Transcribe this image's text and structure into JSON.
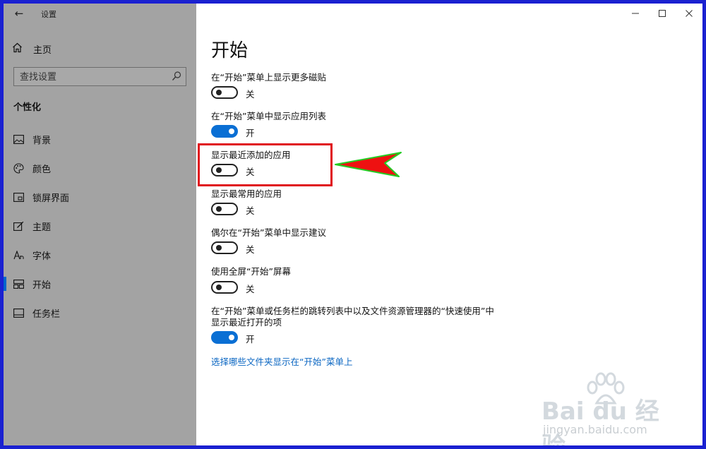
{
  "window": {
    "app_title": "设置",
    "back_icon": "back-arrow-icon",
    "controls": [
      "minimize-icon",
      "maximize-icon",
      "close-icon"
    ]
  },
  "sidebar": {
    "home_label": "主页",
    "search_placeholder": "查找设置",
    "section_title": "个性化",
    "items": [
      {
        "label": "背景",
        "icon": "image-icon",
        "active": false
      },
      {
        "label": "颜色",
        "icon": "palette-icon",
        "active": false
      },
      {
        "label": "锁屏界面",
        "icon": "lock-screen-icon",
        "active": false
      },
      {
        "label": "主题",
        "icon": "theme-icon",
        "active": false
      },
      {
        "label": "字体",
        "icon": "font-icon",
        "active": false
      },
      {
        "label": "开始",
        "icon": "start-icon",
        "active": true
      },
      {
        "label": "任务栏",
        "icon": "taskbar-icon",
        "active": false
      }
    ]
  },
  "main": {
    "title": "开始",
    "settings": [
      {
        "label": "在“开始”菜单上显示更多磁贴",
        "state": "关",
        "on": false
      },
      {
        "label": "在“开始”菜单中显示应用列表",
        "state": "开",
        "on": true
      },
      {
        "label": "显示最近添加的应用",
        "state": "关",
        "on": false
      },
      {
        "label": "显示最常用的应用",
        "state": "关",
        "on": false
      },
      {
        "label": "偶尔在“开始”菜单中显示建议",
        "state": "关",
        "on": false
      },
      {
        "label": "使用全屏“开始”屏幕",
        "state": "关",
        "on": false
      },
      {
        "label_line1": "在“开始”菜单或任务栏的跳转列表中以及文件资源管理器的“快速使用”中",
        "label_line2": "显示最近打开的项",
        "state": "开",
        "on": true
      }
    ],
    "link": "选择哪些文件夹显示在“开始”菜单上"
  },
  "watermark": {
    "main": "Bai du 经验",
    "sub": "jingyan.baidu.com"
  },
  "colors": {
    "accent": "#0a6fd4",
    "sidebar_bg": "#a3a3a3",
    "highlight": "#e0121b",
    "arrow": "#ee1111",
    "arrow_outline": "#22cc22",
    "frame": "#1a22d0"
  }
}
